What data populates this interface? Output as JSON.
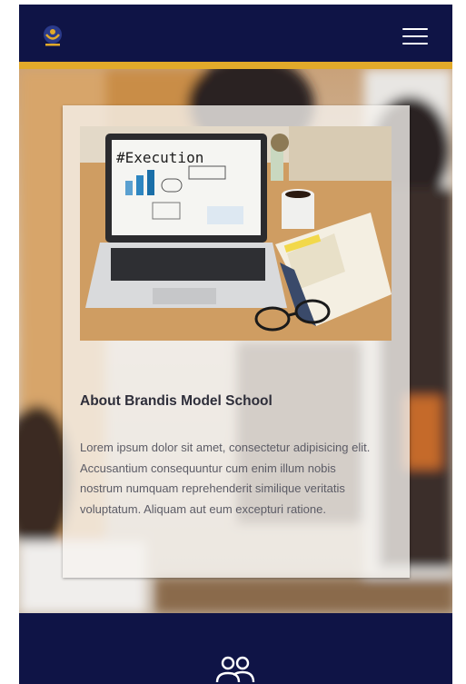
{
  "header": {
    "logo_icon": "school-crest-icon",
    "menu_icon": "hamburger-menu-icon"
  },
  "about": {
    "image_text": "#Execution",
    "title": "About Brandis Model School",
    "body": "Lorem ipsum dolor sit amet, consectetur adipisicing elit. Accusantium consequuntur cum enim illum nobis nostrum numquam reprehenderit similique veritatis voluptatum. Aliquam aut eum excepturi ratione."
  },
  "footer": {
    "icon": "users-icon"
  },
  "colors": {
    "navy": "#0f1446",
    "gold": "#e2aa2a",
    "title": "#2e2e3a",
    "body": "#5c5c66"
  }
}
